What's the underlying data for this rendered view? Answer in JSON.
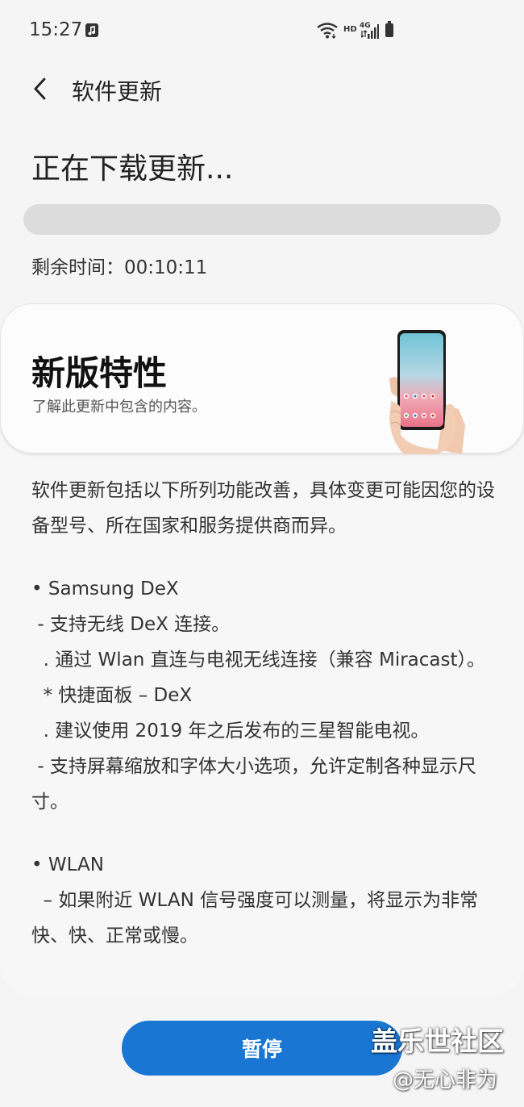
{
  "status_bar": {
    "time": "15:27",
    "hd": "HD",
    "network": "4G",
    "icons": [
      "music-icon",
      "wifi-icon",
      "signal-icon",
      "battery-icon"
    ]
  },
  "header": {
    "title": "软件更新"
  },
  "download": {
    "heading": "正在下载更新...",
    "progress_percent": 0,
    "remaining_label": "剩余时间：",
    "remaining_value": "00:10:11"
  },
  "features": {
    "title": "新版特性",
    "subtitle": "了解此更新中包含的内容。",
    "notes": [
      "软件更新包括以下所列功能改善，具体变更可能因您的设备型号、所在国家和服务提供商而异。",
      "• Samsung DeX",
      " - 支持无线 DeX 连接。",
      "  . 通过 Wlan 直连与电视无线连接（兼容 Miracast）。",
      "  * 快捷面板 – DeX",
      "  . 建议使用 2019 年之后发布的三星智能电视。",
      " - 支持屏幕缩放和字体大小选项，允许定制各种显示尺寸。",
      "• WLAN",
      "  – 如果附近 WLAN 信号强度可以测量，将显示为非常快、快、正常或慢。"
    ]
  },
  "actions": {
    "pause_label": "暂停"
  },
  "watermark": {
    "line1": "盖乐世社区",
    "line2": "@无心非为"
  },
  "colors": {
    "accent": "#1976d2",
    "background": "#f5f5f5",
    "track": "#dcdcdc"
  }
}
